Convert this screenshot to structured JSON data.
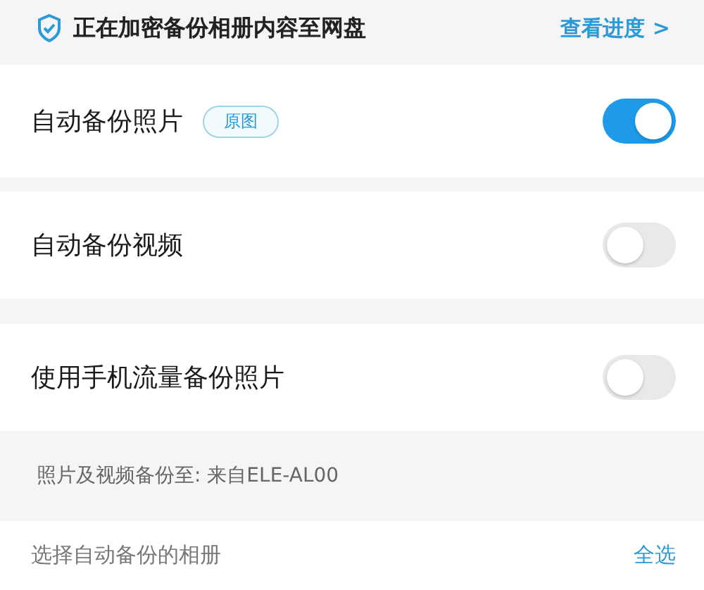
{
  "banner": {
    "text": "正在加密备份相册内容至网盘",
    "link": "查看进度 >"
  },
  "settings": [
    {
      "label": "自动备份照片",
      "badge": "原图",
      "on": true
    },
    {
      "label": "自动备份视频",
      "on": false
    },
    {
      "label": "使用手机流量备份照片",
      "on": false
    }
  ],
  "destination": "照片及视频备份至: 来自ELE-AL00",
  "album_row": {
    "label": "选择自动备份的相册",
    "action": "全选"
  }
}
